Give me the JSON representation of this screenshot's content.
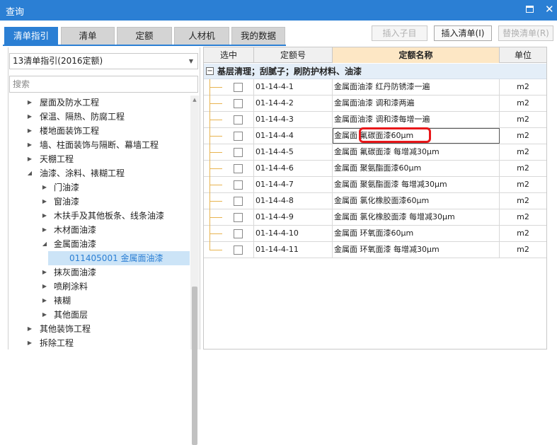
{
  "window": {
    "title": "查询"
  },
  "tabs": [
    {
      "label": "清单指引"
    },
    {
      "label": "清单"
    },
    {
      "label": "定额"
    },
    {
      "label": "人材机"
    },
    {
      "label": "我的数据"
    }
  ],
  "toolbar": {
    "insert_child": "插入子目",
    "insert_list": "插入清单(I)",
    "replace_list": "替换清单(R)"
  },
  "left": {
    "select_value": "13清单指引(2016定额)",
    "search_placeholder": "搜索",
    "tree": [
      {
        "label": "屋面及防水工程"
      },
      {
        "label": "保温、隔热、防腐工程"
      },
      {
        "label": "楼地面装饰工程"
      },
      {
        "label": "墙、柱面装饰与隔断、幕墙工程"
      },
      {
        "label": "天棚工程"
      },
      {
        "label": "油漆、涂料、裱糊工程"
      },
      {
        "label": "门油漆"
      },
      {
        "label": "窗油漆"
      },
      {
        "label": "木扶手及其他板条、线条油漆"
      },
      {
        "label": "木材面油漆"
      },
      {
        "label": "金属面油漆"
      },
      {
        "label": "011405001  金属面油漆"
      },
      {
        "label": "抹灰面油漆"
      },
      {
        "label": "喷刷涂料"
      },
      {
        "label": "裱糊"
      },
      {
        "label": "其他面层"
      },
      {
        "label": "其他装饰工程"
      },
      {
        "label": "拆除工程"
      }
    ]
  },
  "grid": {
    "headers": {
      "select": "选中",
      "code": "定额号",
      "name": "定额名称",
      "unit": "单位"
    },
    "group_label": "基层清理；刮腻子；刷防护材料、油漆",
    "rows": [
      {
        "code": "01-14-4-1",
        "name": "金属面油漆 红丹防锈漆一遍",
        "unit": "m2"
      },
      {
        "code": "01-14-4-2",
        "name": "金属面油漆 调和漆两遍",
        "unit": "m2"
      },
      {
        "code": "01-14-4-3",
        "name": "金属面油漆 调和漆每增一遍",
        "unit": "m2"
      },
      {
        "code": "01-14-4-4",
        "name": "金属面 氟碳面漆60μm",
        "unit": "m2"
      },
      {
        "code": "01-14-4-5",
        "name": "金属面 氟碳面漆 每增减30μm",
        "unit": "m2"
      },
      {
        "code": "01-14-4-6",
        "name": "金属面 聚氨酯面漆60μm",
        "unit": "m2"
      },
      {
        "code": "01-14-4-7",
        "name": "金属面 聚氨酯面漆 每增减30μm",
        "unit": "m2"
      },
      {
        "code": "01-14-4-8",
        "name": "金属面 氯化橡胶面漆60μm",
        "unit": "m2"
      },
      {
        "code": "01-14-4-9",
        "name": "金属面 氯化橡胶面漆 每增减30μm",
        "unit": "m2"
      },
      {
        "code": "01-14-4-10",
        "name": "金属面 环氧面漆60μm",
        "unit": "m2"
      },
      {
        "code": "01-14-4-11",
        "name": "金属面 环氧面漆 每增减30μm",
        "unit": "m2"
      }
    ]
  },
  "colors": {
    "accent": "#2b7fd4",
    "highlight_box": "#e8171a",
    "header_name_bg": "#fde7c5"
  }
}
